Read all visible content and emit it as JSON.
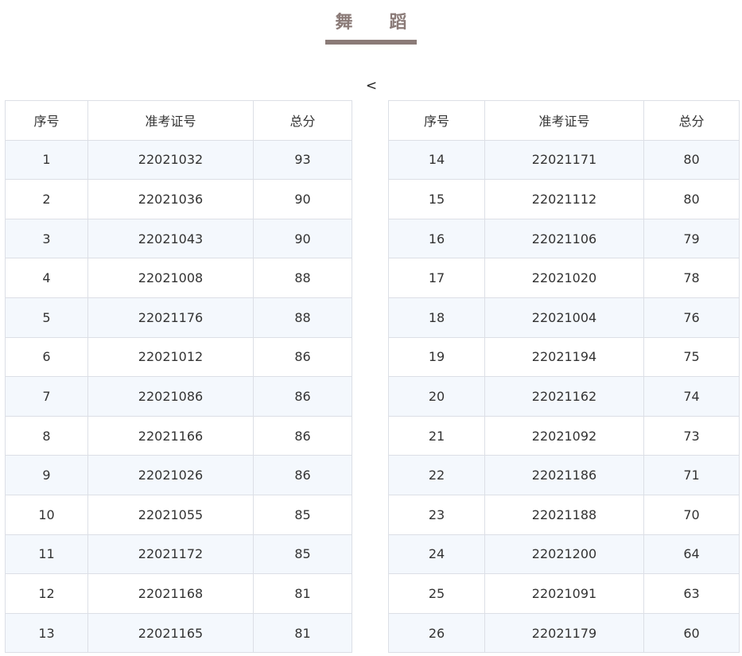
{
  "page": {
    "title": "舞　蹈",
    "prev_arrow": "<"
  },
  "table": {
    "headers": [
      "序号",
      "准考证号",
      "总分"
    ],
    "left_rows": [
      [
        "1",
        "22021032",
        "93"
      ],
      [
        "2",
        "22021036",
        "90"
      ],
      [
        "3",
        "22021043",
        "90"
      ],
      [
        "4",
        "22021008",
        "88"
      ],
      [
        "5",
        "22021176",
        "88"
      ],
      [
        "6",
        "22021012",
        "86"
      ],
      [
        "7",
        "22021086",
        "86"
      ],
      [
        "8",
        "22021166",
        "86"
      ],
      [
        "9",
        "22021026",
        "86"
      ],
      [
        "10",
        "22021055",
        "85"
      ],
      [
        "11",
        "22021172",
        "85"
      ],
      [
        "12",
        "22021168",
        "81"
      ],
      [
        "13",
        "22021165",
        "81"
      ]
    ],
    "right_rows": [
      [
        "14",
        "22021171",
        "80"
      ],
      [
        "15",
        "22021112",
        "80"
      ],
      [
        "16",
        "22021106",
        "79"
      ],
      [
        "17",
        "22021020",
        "78"
      ],
      [
        "18",
        "22021004",
        "76"
      ],
      [
        "19",
        "22021194",
        "75"
      ],
      [
        "20",
        "22021162",
        "74"
      ],
      [
        "21",
        "22021092",
        "73"
      ],
      [
        "22",
        "22021186",
        "71"
      ],
      [
        "23",
        "22021188",
        "70"
      ],
      [
        "24",
        "22021200",
        "64"
      ],
      [
        "25",
        "22021091",
        "63"
      ],
      [
        "26",
        "22021179",
        "60"
      ]
    ]
  }
}
